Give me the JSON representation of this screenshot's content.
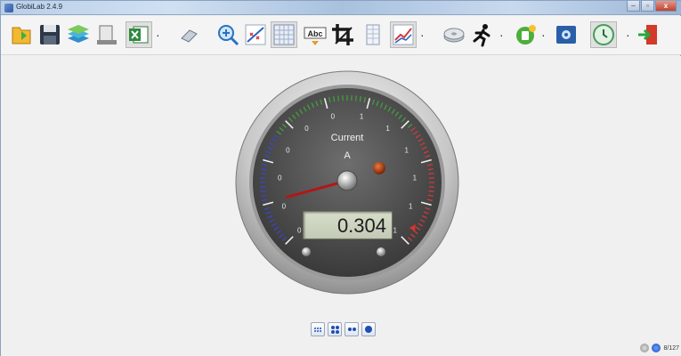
{
  "window": {
    "title": "GlobiLab 2.4.9",
    "controls": {
      "minimize": "–",
      "maximize": "▫",
      "close": "x"
    }
  },
  "toolbar": {
    "buttons": [
      {
        "name": "open-icon",
        "tooltip": ""
      },
      {
        "name": "save-icon",
        "tooltip": ""
      },
      {
        "name": "layers-icon",
        "tooltip": ""
      },
      {
        "name": "clipboard-icon",
        "tooltip": ""
      },
      {
        "name": "excel-icon",
        "tooltip": ""
      },
      {
        "name": "eraser-icon",
        "tooltip": ""
      },
      {
        "name": "zoom-icon",
        "tooltip": ""
      },
      {
        "name": "curve-fit-icon",
        "tooltip": ""
      },
      {
        "name": "grid-icon",
        "tooltip": ""
      },
      {
        "name": "annotate-abc-icon",
        "tooltip": ""
      },
      {
        "name": "crop-icon",
        "tooltip": ""
      },
      {
        "name": "table-icon",
        "tooltip": ""
      },
      {
        "name": "graph-icon",
        "tooltip": ""
      },
      {
        "name": "disk-icon",
        "tooltip": ""
      },
      {
        "name": "run-icon",
        "tooltip": ""
      },
      {
        "name": "sensor-icon",
        "tooltip": ""
      },
      {
        "name": "settings-panel-icon",
        "tooltip": ""
      },
      {
        "name": "clock-icon",
        "tooltip": ""
      },
      {
        "name": "exit-icon",
        "tooltip": ""
      }
    ],
    "abc_label": "Abc"
  },
  "gauge": {
    "title": "Current",
    "unit": "A",
    "value": "0.304",
    "scale_labels_left": [
      "0",
      "0",
      "0",
      "0",
      "0"
    ],
    "scale_labels_top": [
      "0",
      "1",
      "1"
    ],
    "scale_labels_right": [
      "1",
      "1",
      "1",
      "1"
    ],
    "needle_fraction": 0.11,
    "colors": {
      "blue_zone": "#3b47c9",
      "green_zone": "#3fa53a",
      "red_zone": "#d83a3a",
      "needle": "#b01818"
    }
  },
  "layouts": {
    "buttons": [
      "layout-9-icon",
      "layout-4-icon",
      "layout-2-icon",
      "layout-1-icon"
    ]
  },
  "status": {
    "count": "8/127"
  }
}
